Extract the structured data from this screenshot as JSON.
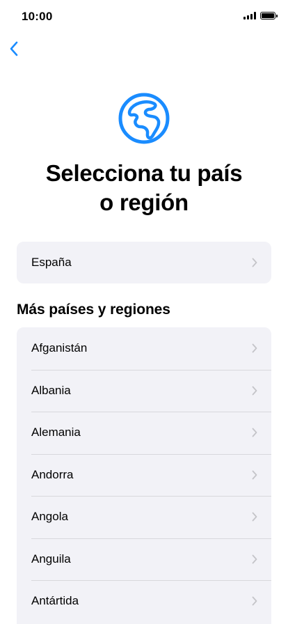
{
  "status_bar": {
    "time": "10:00"
  },
  "navigation": {
    "back_icon": "chevron-left-icon"
  },
  "header": {
    "icon": "globe-icon",
    "title_line1": "Selecciona tu país",
    "title_line2": "o región"
  },
  "featured": {
    "items": [
      {
        "label": "España"
      }
    ]
  },
  "more": {
    "section_title": "Más países y regiones",
    "items": [
      {
        "label": "Afganistán"
      },
      {
        "label": "Albania"
      },
      {
        "label": "Alemania"
      },
      {
        "label": "Andorra"
      },
      {
        "label": "Angola"
      },
      {
        "label": "Anguila"
      },
      {
        "label": "Antártida"
      }
    ]
  },
  "colors": {
    "accent": "#1a8cff",
    "card_background": "#f2f2f7",
    "chevron": "#c4c4c8",
    "separator": "#d8d8dc"
  }
}
